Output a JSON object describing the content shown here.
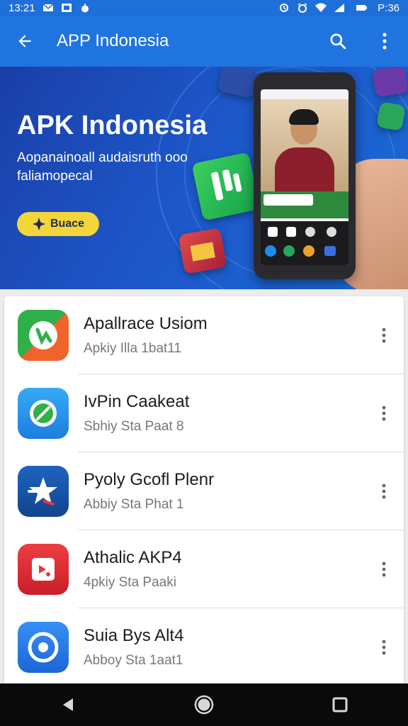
{
  "status_bar": {
    "time": "13:21",
    "battery_time": "P:36",
    "left_icons": [
      "mail-icon",
      "image-icon",
      "apple-icon"
    ],
    "right_icons": [
      "alarm-icon",
      "alarm-clock-icon",
      "wifi-icon",
      "signal-icon",
      "battery-icon"
    ]
  },
  "app_bar": {
    "title": "APP Indonesia",
    "back_icon": "arrow-back-icon",
    "actions": [
      "search-icon",
      "more-vert-icon"
    ],
    "color": "#1f74e0"
  },
  "banner": {
    "title": "APK Indonesia",
    "subtitle": "Aopanainoall audaisruth ooo faliamopecal",
    "button_label": "Buace",
    "button_icon": "star-sparkle-icon",
    "button_color": "#f4d63a"
  },
  "apps": [
    {
      "name": "Apallrace Usiom",
      "subtitle": "Apkiy Illa 1bat11",
      "icon": "chat-bubble-logo-icon",
      "colors": [
        "#2fb04a",
        "#f0632a"
      ]
    },
    {
      "name": "IvPin Caakeat",
      "subtitle": "Sbhiy Sta Paat 8",
      "icon": "compass-leaf-icon",
      "colors": [
        "#2ea3f2",
        "#1d7ee0"
      ]
    },
    {
      "name": "Pyoly Gcofl Plenr",
      "subtitle": "Abbiy Sta Phat 1",
      "icon": "star-logo-icon",
      "colors": [
        "#1c5fb8",
        "#11448f"
      ]
    },
    {
      "name": "Athalic AKP4",
      "subtitle": "4pkiy Sta Paaki",
      "icon": "photo-frame-icon",
      "colors": [
        "#e8353a",
        "#c91f2a"
      ]
    },
    {
      "name": "Suia Bys Alt4",
      "subtitle": "Abboy Sta 1aat1",
      "icon": "target-circle-icon",
      "colors": [
        "#2f86f2",
        "#1b66d6"
      ]
    }
  ],
  "row_menu_icon": "more-vert-icon",
  "nav_bar": {
    "buttons": [
      "back-triangle-icon",
      "home-circle-icon",
      "recents-square-icon"
    ]
  }
}
